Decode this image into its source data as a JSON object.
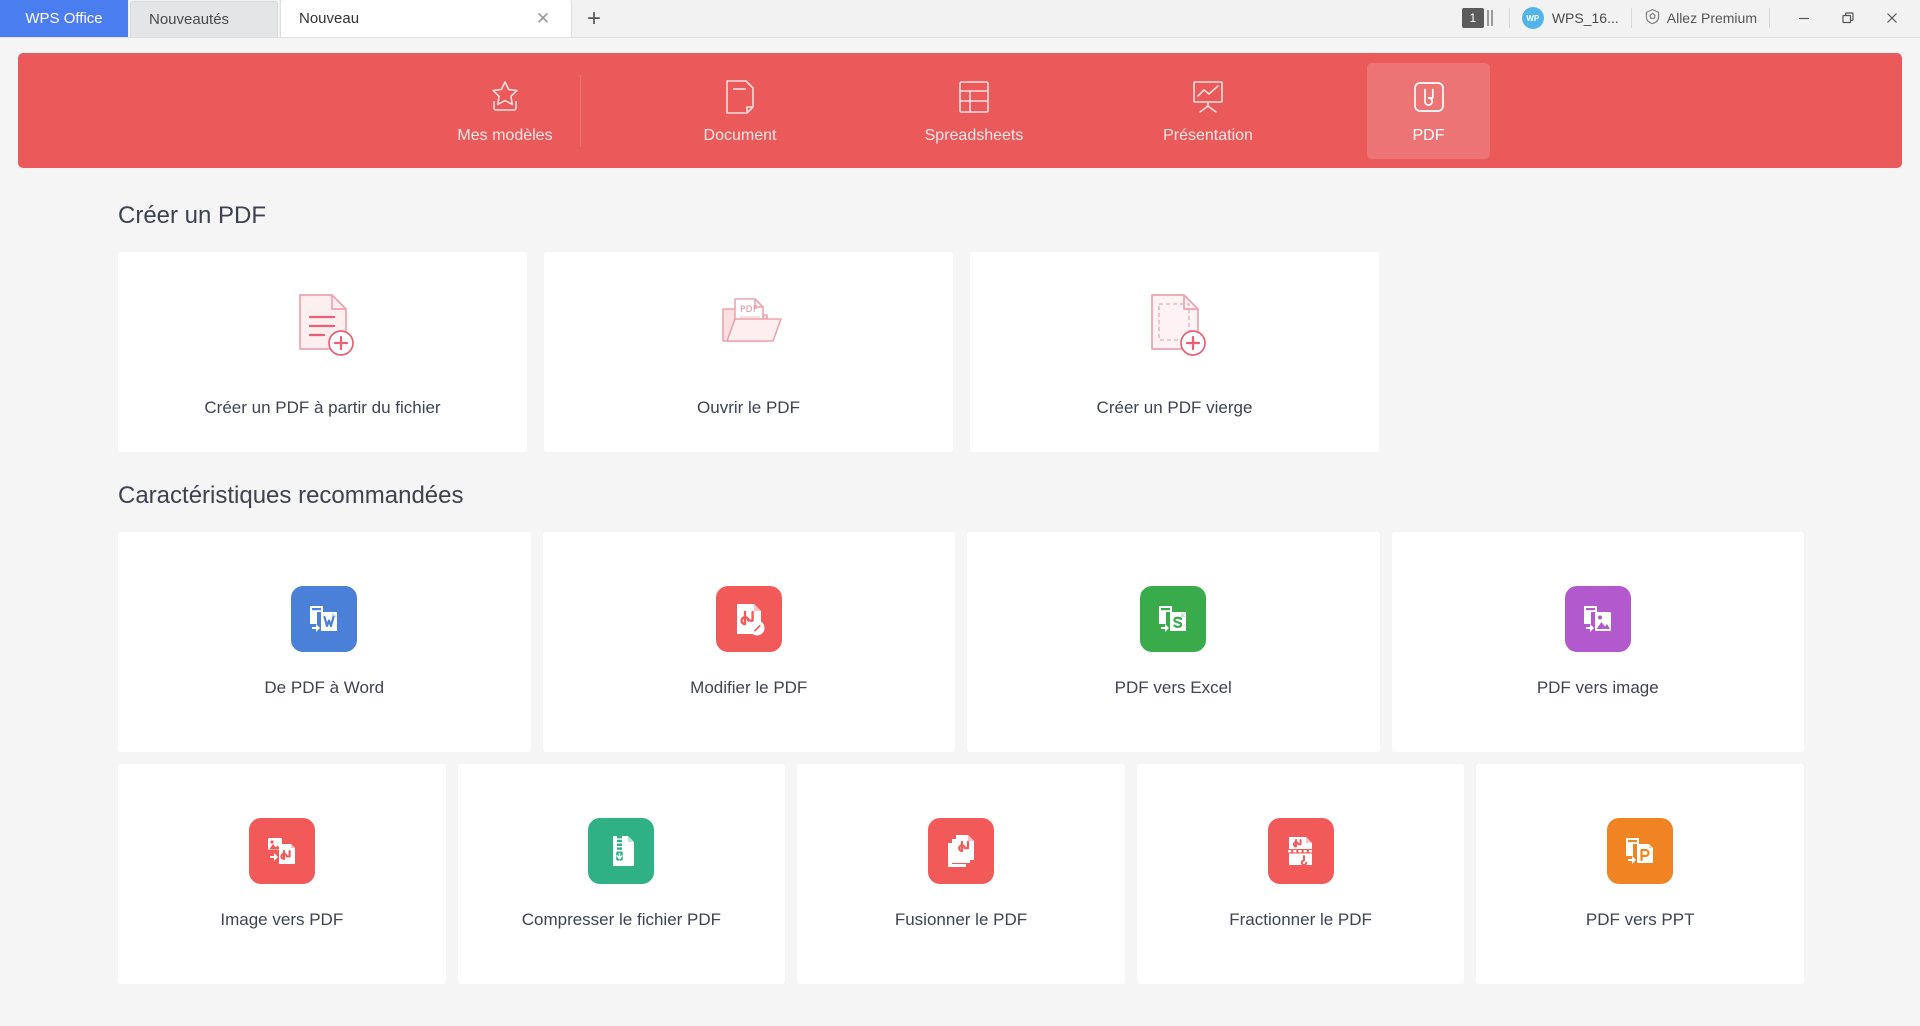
{
  "titlebar": {
    "app_button": "WPS Office",
    "tabs": [
      {
        "label": "Nouveautés",
        "active": false
      },
      {
        "label": "Nouveau",
        "active": true
      }
    ],
    "new_tab_label": "+",
    "close_tab_label": "✕",
    "window_count": "1",
    "user_name": "WPS_16...",
    "premium_label": "Allez Premium",
    "minimize_label": "Minimiser",
    "restore_label": "Restaurer",
    "close_label": "Fermer"
  },
  "banner": {
    "accent_color": "#ea5a5a",
    "categories": [
      {
        "label": "Mes modèles",
        "icon": "star-tray-icon",
        "selected": false
      },
      {
        "label": "Document",
        "icon": "document-icon",
        "selected": false
      },
      {
        "label": "Spreadsheets",
        "icon": "spreadsheet-grid-icon",
        "selected": false
      },
      {
        "label": "Présentation",
        "icon": "presentation-chart-icon",
        "selected": false
      },
      {
        "label": "PDF",
        "icon": "pdf-icon",
        "selected": true
      }
    ]
  },
  "create_section": {
    "title": "Créer un PDF",
    "cards": [
      {
        "label": "Créer un PDF à partir du fichier",
        "icon": "document-plus-icon"
      },
      {
        "label": "Ouvrir le PDF",
        "icon": "folder-pdf-icon",
        "badge_text": "PDF"
      },
      {
        "label": "Créer un PDF vierge",
        "icon": "blank-page-plus-icon"
      }
    ]
  },
  "recommended_section": {
    "title": "Caractéristiques recommandées",
    "row1": [
      {
        "label": "De PDF à Word",
        "icon": "pdf-to-word-icon",
        "color": "#4a80d8"
      },
      {
        "label": "Modifier le PDF",
        "icon": "pdf-edit-icon",
        "color": "#f25a5a"
      },
      {
        "label": "PDF vers Excel",
        "icon": "pdf-to-excel-icon",
        "color": "#3aab4b"
      },
      {
        "label": "PDF vers image",
        "icon": "pdf-to-image-icon",
        "color": "#b259ce"
      }
    ],
    "row2": [
      {
        "label": "Image vers PDF",
        "icon": "image-to-pdf-icon",
        "color": "#f25a5a"
      },
      {
        "label": "Compresser le fichier PDF",
        "icon": "pdf-compress-icon",
        "color": "#2fb185"
      },
      {
        "label": "Fusionner le PDF",
        "icon": "pdf-merge-icon",
        "color": "#f25a5a"
      },
      {
        "label": "Fractionner le PDF",
        "icon": "pdf-split-icon",
        "color": "#f25a5a"
      },
      {
        "label": "PDF vers PPT",
        "icon": "pdf-to-ppt-icon",
        "color": "#f08322"
      }
    ]
  }
}
